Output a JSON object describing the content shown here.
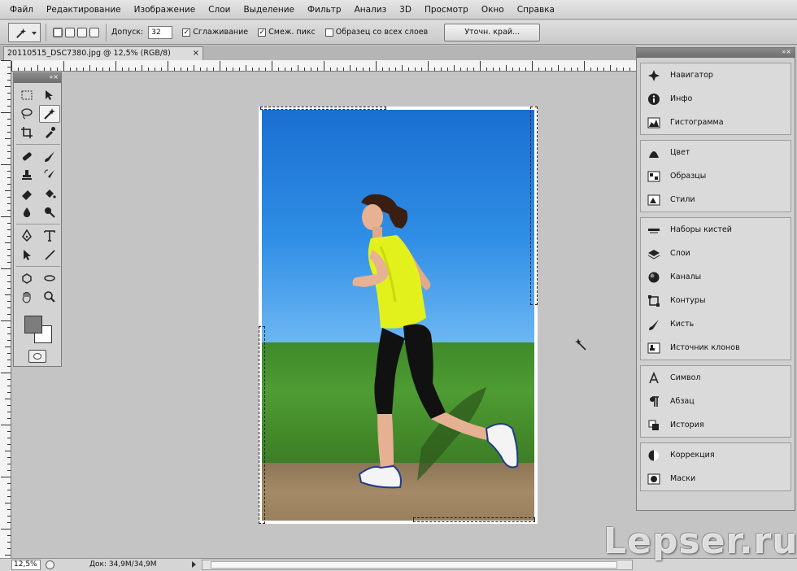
{
  "menu": {
    "items": [
      "Файл",
      "Редактирование",
      "Изображение",
      "Слои",
      "Выделение",
      "Фильтр",
      "Анализ",
      "3D",
      "Просмотр",
      "Окно",
      "Справка"
    ]
  },
  "options": {
    "tolerance_label": "Допуск:",
    "tolerance_value": "32",
    "antialias_label": "Сглаживание",
    "antialias_checked": true,
    "contiguous_label": "Смеж. пикс",
    "contiguous_checked": true,
    "sample_all_label": "Образец со всех слоев",
    "sample_all_checked": false,
    "refine_edge_label": "Уточн. край..."
  },
  "document": {
    "tab_title": "20110515_DSC7380.jpg @ 12,5% (RGB/8)",
    "close_symbol": "×"
  },
  "panels": {
    "groups": [
      [
        {
          "label": "Навигатор",
          "icon": "navigator-icon"
        },
        {
          "label": "Инфо",
          "icon": "info-icon"
        },
        {
          "label": "Гистограмма",
          "icon": "histogram-icon"
        }
      ],
      [
        {
          "label": "Цвет",
          "icon": "color-icon"
        },
        {
          "label": "Образцы",
          "icon": "swatches-icon"
        },
        {
          "label": "Стили",
          "icon": "styles-icon"
        }
      ],
      [
        {
          "label": "Наборы кистей",
          "icon": "brush-presets-icon"
        },
        {
          "label": "Слои",
          "icon": "layers-icon"
        },
        {
          "label": "Каналы",
          "icon": "channels-icon"
        },
        {
          "label": "Контуры",
          "icon": "paths-icon"
        },
        {
          "label": "Кисть",
          "icon": "brush-icon"
        },
        {
          "label": "Источник клонов",
          "icon": "clone-source-icon"
        }
      ],
      [
        {
          "label": "Символ",
          "icon": "character-icon"
        },
        {
          "label": "Абзац",
          "icon": "paragraph-icon"
        },
        {
          "label": "История",
          "icon": "history-icon"
        }
      ],
      [
        {
          "label": "Коррекция",
          "icon": "adjustments-icon"
        },
        {
          "label": "Маски",
          "icon": "masks-icon"
        }
      ]
    ]
  },
  "status": {
    "zoom": "12,5%",
    "doc_size": "Док: 34,9М/34,9М"
  },
  "watermark": "Lepser.ru",
  "colors": {
    "foreground": "#7d7d7d",
    "background": "#ffffff",
    "canvas_bg": "#c4c4c4"
  }
}
